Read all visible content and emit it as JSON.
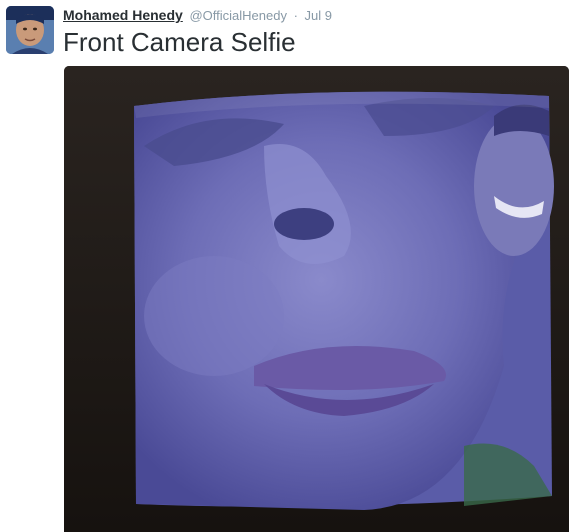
{
  "tweet": {
    "fullname": "Mohamed Henedy",
    "handle": "@OfficialHenedy",
    "separator": "·",
    "timestamp": "Jul 9",
    "text": "Front Camera Selfie"
  },
  "icons": {
    "avatar": "profile-photo",
    "media": "photo-of-face-on-crt-tv-screen"
  },
  "colors": {
    "text": "#292f33",
    "secondary": "#8899a6",
    "screen_blue": "#6e6fb8"
  }
}
